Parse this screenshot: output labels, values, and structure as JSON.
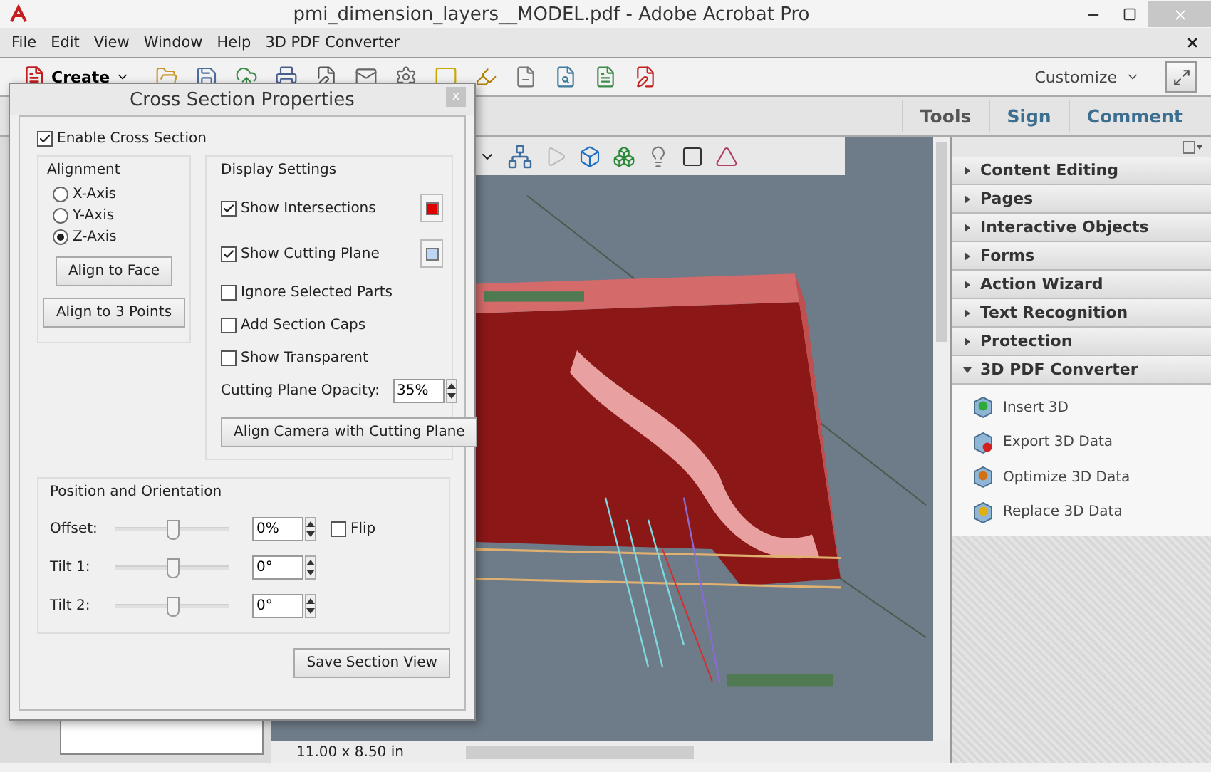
{
  "window": {
    "title": "pmi_dimension_layers__MODEL.pdf - Adobe Acrobat Pro"
  },
  "menu": [
    "File",
    "Edit",
    "View",
    "Window",
    "Help",
    "3D PDF Converter"
  ],
  "toolbar": {
    "create": "Create",
    "customize": "Customize"
  },
  "tabs": [
    {
      "label": "Tools"
    },
    {
      "label": "Sign"
    },
    {
      "label": "Comment"
    }
  ],
  "panels": [
    {
      "label": "Content Editing",
      "expanded": false
    },
    {
      "label": "Pages",
      "expanded": false
    },
    {
      "label": "Interactive Objects",
      "expanded": false
    },
    {
      "label": "Forms",
      "expanded": false
    },
    {
      "label": "Action Wizard",
      "expanded": false
    },
    {
      "label": "Text Recognition",
      "expanded": false
    },
    {
      "label": "Protection",
      "expanded": false
    },
    {
      "label": "3D PDF Converter",
      "expanded": true,
      "items": [
        {
          "label": "Insert 3D",
          "kind": "insert"
        },
        {
          "label": "Export 3D Data",
          "kind": "export"
        },
        {
          "label": "Optimize 3D Data",
          "kind": "optimize"
        },
        {
          "label": "Replace 3D Data",
          "kind": "replace"
        }
      ]
    }
  ],
  "status": {
    "page_size": "11.00 x 8.50 in"
  },
  "dialog": {
    "title": "Cross Section Properties",
    "close": "x",
    "enable": {
      "label": "Enable Cross Section",
      "checked": true
    },
    "alignment": {
      "title": "Alignment",
      "options": [
        {
          "label": "X-Axis",
          "selected": false
        },
        {
          "label": "Y-Axis",
          "selected": false
        },
        {
          "label": "Z-Axis",
          "selected": true
        }
      ],
      "buttons": [
        "Align to Face",
        "Align to 3 Points"
      ]
    },
    "display": {
      "title": "Display Settings",
      "options": [
        {
          "label": "Show Intersections",
          "checked": true,
          "color": "#e00000"
        },
        {
          "label": "Show Cutting Plane",
          "checked": true,
          "color": "#bcd6f4"
        },
        {
          "label": "Ignore Selected Parts",
          "checked": false
        },
        {
          "label": "Add Section Caps",
          "checked": false
        },
        {
          "label": "Show Transparent",
          "checked": false
        }
      ],
      "opacity": {
        "label": "Cutting Plane Opacity:",
        "value": "35%"
      },
      "button": "Align Camera with Cutting Plane"
    },
    "position": {
      "title": "Position and Orientation",
      "rows": [
        {
          "label": "Offset:",
          "level": 0.5,
          "value": "0%",
          "flip": {
            "label": "Flip",
            "checked": false
          }
        },
        {
          "label": "Tilt 1:",
          "level": 0.5,
          "value": "0°"
        },
        {
          "label": "Tilt 2:",
          "level": 0.5,
          "value": "0°"
        }
      ]
    },
    "save": "Save Section View"
  }
}
